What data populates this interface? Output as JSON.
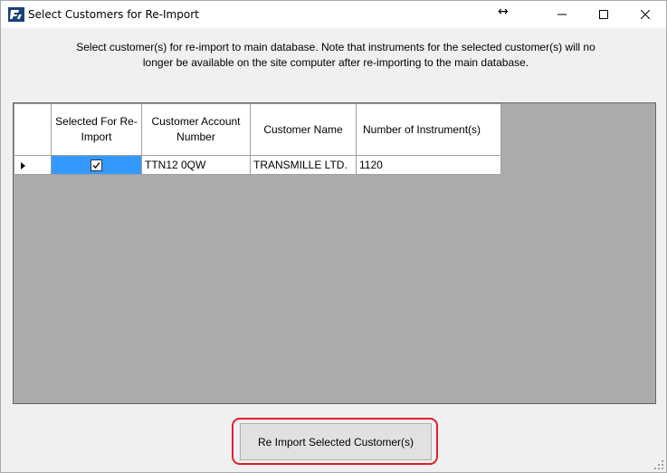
{
  "window": {
    "title": "Select Customers for Re-Import",
    "resize_glyph": "↔"
  },
  "instructions": "Select customer(s) for re-import to main database. Note that instruments for the selected customer(s) will no longer be available on the site computer after re-importing to the main database.",
  "grid": {
    "columns": [
      {
        "label": "Selected For Re-Import"
      },
      {
        "label": "Customer Account Number"
      },
      {
        "label": "Customer Name"
      },
      {
        "label": "Number of Instrument(s)"
      }
    ],
    "rows": [
      {
        "selected": true,
        "account_number": "TTN12 0QW",
        "name": "TRANSMILLE LTD.",
        "instrument_count": "1120"
      }
    ]
  },
  "buttons": {
    "reimport_label": "Re Import Selected Customer(s)"
  },
  "colors": {
    "selection": "#3399ff",
    "grid_background": "#ababab",
    "highlight": "#e0202a"
  }
}
